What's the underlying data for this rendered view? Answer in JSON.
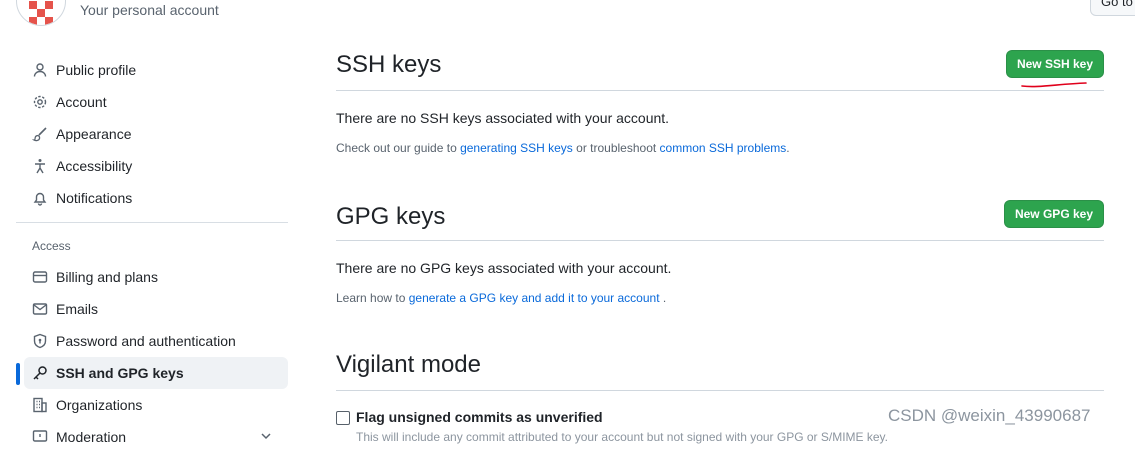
{
  "header": {
    "account_subtitle": "Your personal account",
    "goto_button_label": "Go to"
  },
  "sidebar": {
    "items": [
      {
        "label": "Public profile",
        "icon": "person-icon"
      },
      {
        "label": "Account",
        "icon": "gear-icon"
      },
      {
        "label": "Appearance",
        "icon": "paintbrush-icon"
      },
      {
        "label": "Accessibility",
        "icon": "accessibility-icon"
      },
      {
        "label": "Notifications",
        "icon": "bell-icon"
      }
    ],
    "access_heading": "Access",
    "access_items": [
      {
        "label": "Billing and plans",
        "icon": "credit-card-icon"
      },
      {
        "label": "Emails",
        "icon": "mail-icon"
      },
      {
        "label": "Password and authentication",
        "icon": "shield-lock-icon"
      },
      {
        "label": "SSH and GPG keys",
        "icon": "key-icon",
        "active": true
      },
      {
        "label": "Organizations",
        "icon": "organization-icon"
      },
      {
        "label": "Moderation",
        "icon": "report-icon"
      }
    ]
  },
  "ssh": {
    "title": "SSH keys",
    "new_button": "New SSH key",
    "empty_text": "There are no SSH keys associated with your account.",
    "note_prefix": "Check out our guide to ",
    "note_link1": "generating SSH keys",
    "note_middle": " or troubleshoot ",
    "note_link2": "common SSH problems",
    "note_suffix": "."
  },
  "gpg": {
    "title": "GPG keys",
    "new_button": "New GPG key",
    "empty_text": "There are no GPG keys associated with your account.",
    "note_prefix": "Learn how to ",
    "note_link": "generate a GPG key and add it to your account",
    "note_suffix": " ."
  },
  "vigilant": {
    "title": "Vigilant mode",
    "checkbox_label": "Flag unsigned commits as unverified",
    "checkbox_checked": false,
    "description_partial": "This will include any commit attributed to your account but not signed with your GPG or S/MIME key."
  },
  "watermark": "CSDN @weixin_43990687",
  "colors": {
    "primary_button": "#2da44e",
    "link": "#0969da",
    "active_indicator": "#0969da",
    "annotation_red": "#e0001b"
  }
}
